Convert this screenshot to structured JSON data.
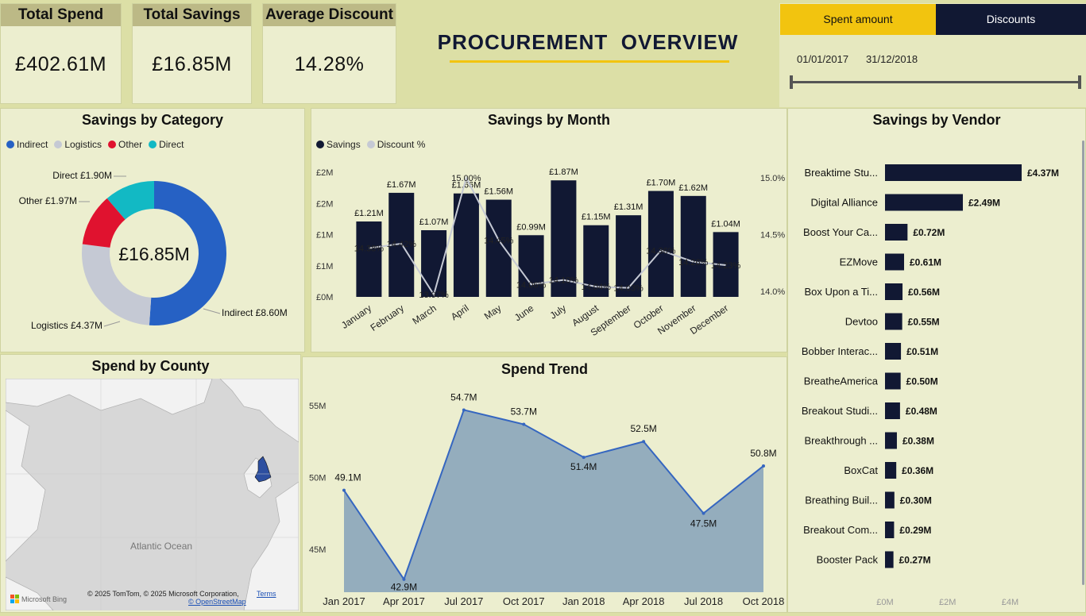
{
  "kpis": [
    {
      "label": "Total Spend",
      "value": "£402.61M"
    },
    {
      "label": "Total Savings",
      "value": "£16.85M"
    },
    {
      "label": "Average Discount",
      "value": "14.28%"
    }
  ],
  "header": {
    "title": "PROCUREMENT  OVERVIEW"
  },
  "tabs": {
    "spent": "Spent amount",
    "discounts": "Discounts"
  },
  "date_range": {
    "start": "01/01/2017",
    "end": "31/12/2018"
  },
  "colors": {
    "navy": "#111833",
    "yellow": "#f2c40f",
    "indirect": "#2661c4",
    "logistics": "#c5c9d4",
    "other": "#e0122f",
    "direct": "#12b9c4",
    "area": "#94adbd",
    "line": "#3566c0"
  },
  "category": {
    "title": "Savings by Category",
    "legend": [
      "Indirect",
      "Logistics",
      "Other",
      "Direct"
    ],
    "center": "£16.85M",
    "labels": {
      "direct": "Direct £1.90M",
      "other": "Other £1.97M",
      "logistics": "Logistics £4.37M",
      "indirect": "Indirect £8.60M"
    }
  },
  "month": {
    "title": "Savings by Month",
    "legend": [
      "Savings",
      "Discount %"
    ]
  },
  "vendor": {
    "title": "Savings by Vendor"
  },
  "county": {
    "title": "Spend by County",
    "ocean": "Atlantic Ocean",
    "bing": "Microsoft Bing",
    "copyright": "© 2025 TomTom, © 2025 Microsoft Corporation,",
    "terms": "Terms",
    "osm": "© OpenStreetMap"
  },
  "trend": {
    "title": "Spend Trend"
  },
  "chart_data": [
    {
      "type": "pie",
      "title": "Savings by Category",
      "categories": [
        "Indirect",
        "Logistics",
        "Other",
        "Direct"
      ],
      "values": [
        8.6,
        4.37,
        1.97,
        1.9
      ],
      "center_label": "£16.85M"
    },
    {
      "type": "bar",
      "title": "Savings by Month",
      "categories": [
        "January",
        "February",
        "March",
        "April",
        "May",
        "June",
        "July",
        "August",
        "September",
        "October",
        "November",
        "December"
      ],
      "series": [
        {
          "name": "Savings",
          "values": [
            1.21,
            1.67,
            1.07,
            1.66,
            1.56,
            0.99,
            1.87,
            1.15,
            1.31,
            1.7,
            1.62,
            1.04
          ],
          "labels": [
            "£1.21M",
            "£1.67M",
            "£1.07M",
            "£1.66M",
            "£1.56M",
            "£0.99M",
            "£1.87M",
            "£1.15M",
            "£1.31M",
            "£1.70M",
            "£1.62M",
            "£1.04M"
          ]
        },
        {
          "name": "Discount %",
          "type": "line",
          "values": [
            14.38,
            14.42,
            13.97,
            15.0,
            14.45,
            14.06,
            14.1,
            14.04,
            14.03,
            14.36,
            14.26,
            14.23
          ],
          "labels": [
            "14.38%",
            "14.42%",
            "13.97%",
            "15.00%",
            "14.45%",
            "14.06%",
            "14.10%",
            "14.04%",
            "14.03%",
            "14.36%",
            "14.26%",
            "14.23%"
          ]
        }
      ],
      "y_ticks": [
        "£0M",
        "£1M",
        "£1M",
        "£2M",
        "£2M"
      ],
      "y2_ticks": [
        "14.0%",
        "14.5%",
        "15.0%"
      ],
      "ylim": [
        0,
        2.0
      ],
      "y2lim": [
        13.95,
        15.05
      ]
    },
    {
      "type": "bar",
      "title": "Savings by Vendor",
      "orientation": "horizontal",
      "categories": [
        "Breaktime Stu...",
        "Digital Alliance",
        "Boost Your Ca...",
        "EZMove",
        "Box Upon a Ti...",
        "Devtoo",
        "Bobber Interac...",
        "BreatheAmerica",
        "Breakout Studi...",
        "Breakthrough ...",
        "BoxCat",
        "Breathing Buil...",
        "Breakout Com...",
        "Booster Pack"
      ],
      "values": [
        4.37,
        2.49,
        0.72,
        0.61,
        0.56,
        0.55,
        0.51,
        0.5,
        0.48,
        0.38,
        0.36,
        0.3,
        0.29,
        0.27
      ],
      "labels": [
        "£4.37M",
        "£2.49M",
        "£0.72M",
        "£0.61M",
        "£0.56M",
        "£0.55M",
        "£0.51M",
        "£0.50M",
        "£0.48M",
        "£0.38M",
        "£0.36M",
        "£0.30M",
        "£0.29M",
        "£0.27M"
      ],
      "x_ticks": [
        "£0M",
        "£2M",
        "£4M"
      ],
      "xlim": [
        0,
        4.7
      ]
    },
    {
      "type": "area",
      "title": "Spend Trend",
      "x": [
        "Jan 2017",
        "Apr 2017",
        "Jul 2017",
        "Oct 2017",
        "Jan 2018",
        "Apr 2018",
        "Jul 2018",
        "Oct 2018"
      ],
      "values": [
        49.1,
        42.9,
        54.7,
        53.7,
        51.4,
        52.5,
        47.5,
        50.8
      ],
      "labels": [
        "49.1M",
        "42.9M",
        "54.7M",
        "53.7M",
        "51.4M",
        "52.5M",
        "47.5M",
        "50.8M"
      ],
      "y_ticks": [
        "45M",
        "50M",
        "55M"
      ],
      "ylim": [
        42.0,
        55.5
      ]
    }
  ]
}
